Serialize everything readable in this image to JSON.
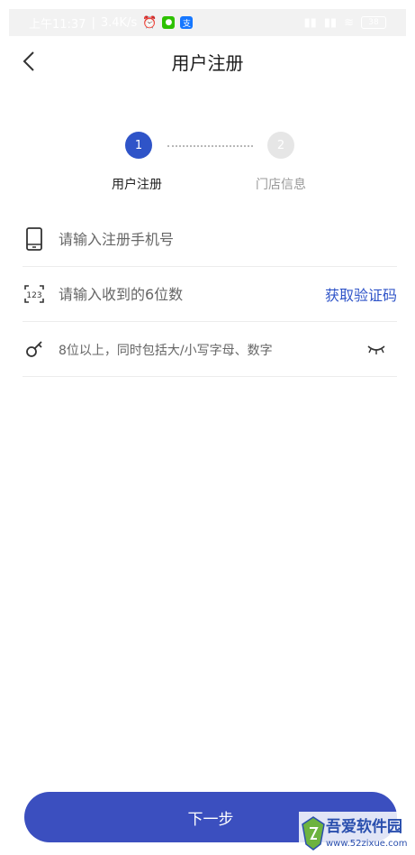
{
  "status_bar": {
    "time": "上午11:37",
    "speed": "3.4K/s",
    "battery": "38"
  },
  "header": {
    "title": "用户注册"
  },
  "stepper": {
    "steps": [
      {
        "number": "1",
        "label": "用户注册",
        "active": true
      },
      {
        "number": "2",
        "label": "门店信息",
        "active": false
      }
    ]
  },
  "form": {
    "phone_placeholder": "请输入注册手机号",
    "code_placeholder": "请输入收到的6位数",
    "get_code_label": "获取验证码",
    "password_placeholder": "8位以上，同时包括大/小写字母、数字"
  },
  "footer": {
    "next_label": "下一步"
  },
  "watermark": {
    "title": "吾爱软件园",
    "url": "www.52zixue.com"
  },
  "colors": {
    "accent": "#2f54c8",
    "button": "#3b4fbf",
    "step_inactive": "#e6e6e6"
  }
}
